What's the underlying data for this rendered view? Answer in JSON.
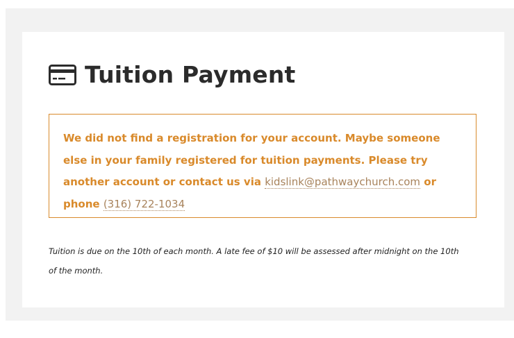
{
  "page": {
    "title": "Tuition Payment",
    "icon": "credit-card-icon"
  },
  "alert": {
    "message": "We did not find a registration for your account. Maybe someone else in your family registered for tuition payments. Please try another account or contact us via",
    "email": "kidslink@pathwaychurch.com",
    "or_phone_label": "or phone",
    "phone": "(316) 722-1034",
    "color": "#d98a2b"
  },
  "note": {
    "text": "Tuition is due on the 10th of each month. A late fee of $10 will be assessed after midnight on the 10th of the month."
  }
}
